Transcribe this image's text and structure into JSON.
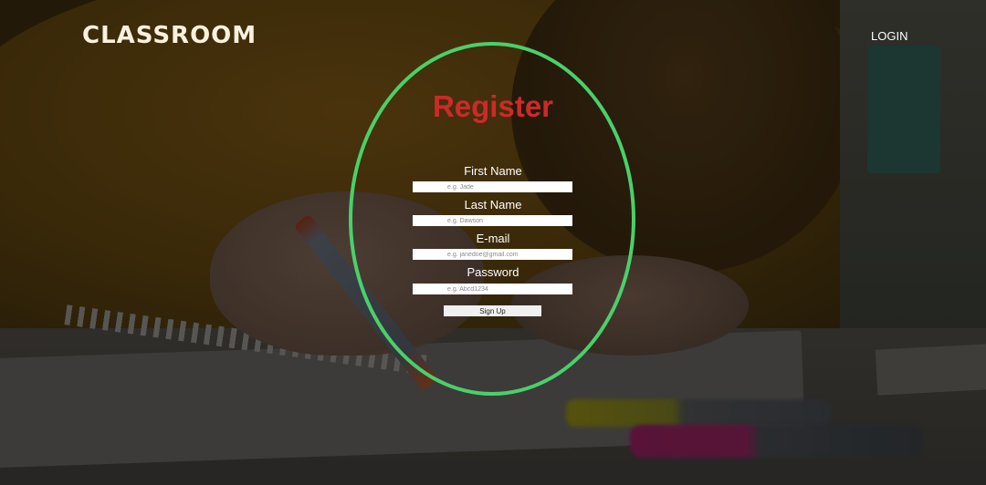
{
  "header": {
    "logo": "CLASSROOM",
    "login_label": "LOGIN"
  },
  "form": {
    "title": "Register",
    "fields": [
      {
        "label": "First Name",
        "placeholder": "e.g. Jade",
        "value": ""
      },
      {
        "label": "Last Name",
        "placeholder": "e.g. Dawson",
        "value": ""
      },
      {
        "label": "E-mail",
        "placeholder": "e.g. janedoe@gmail.com",
        "value": ""
      },
      {
        "label": "Password",
        "placeholder": "e.g. Abcd1234",
        "value": ""
      }
    ],
    "submit_label": "Sign Up"
  },
  "colors": {
    "title": "#cc2a2a",
    "oval_border": "#4ad06a",
    "logo": "#fbf1dc"
  }
}
